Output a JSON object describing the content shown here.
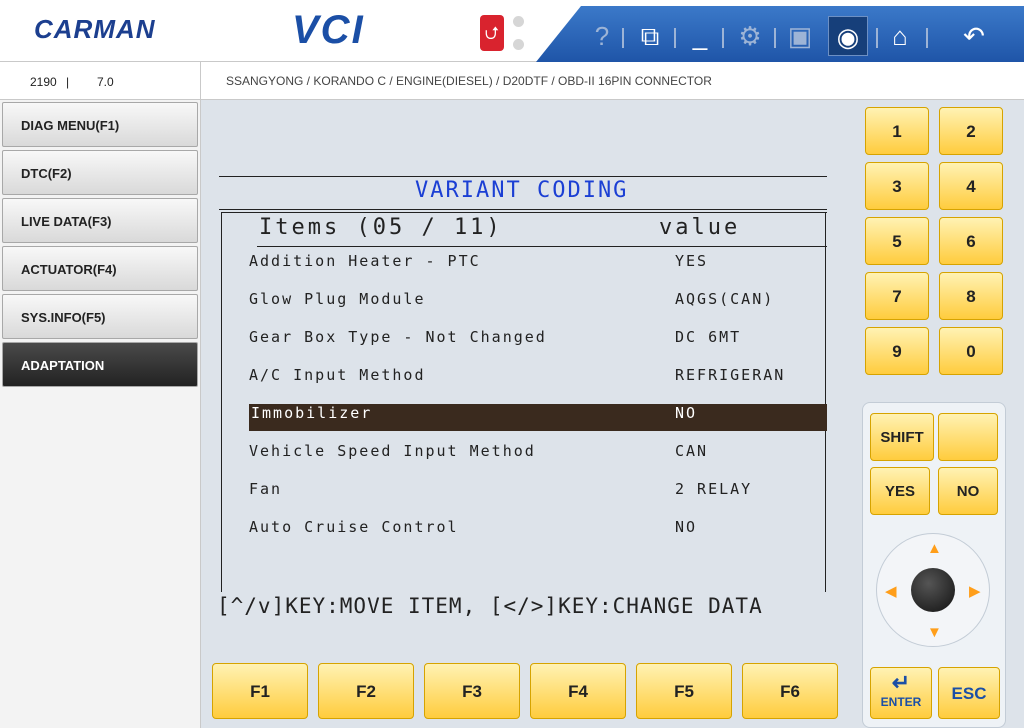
{
  "header": {
    "logo": "CARMAN",
    "product": "VCI",
    "toolbar": {
      "help_icon": "question-icon",
      "window_icon": "window-icon",
      "minimize_icon": "minimize-icon",
      "settings_icon": "gear-icon",
      "save_icon": "save-icon",
      "camera_icon": "camera-icon",
      "home_icon": "home-icon",
      "back_icon": "back-arrow-icon"
    },
    "colors": {
      "toolbar": "#2a63b8",
      "logo": "#1c3f8f",
      "usb": "#d9232e"
    }
  },
  "infobar": {
    "code": "2190",
    "separator": "|",
    "version": "7.0",
    "breadcrumb": "SSANGYONG / KORANDO C / ENGINE(DIESEL) / D20DTF / OBD-II 16PIN CONNECTOR"
  },
  "menu": {
    "items": [
      {
        "label": "DIAG MENU(F1)"
      },
      {
        "label": "DTC(F2)"
      },
      {
        "label": "LIVE DATA(F3)"
      },
      {
        "label": "ACTUATOR(F4)"
      },
      {
        "label": "SYS.INFO(F5)"
      },
      {
        "label": "ADAPTATION",
        "active": true
      }
    ]
  },
  "screen": {
    "title": "VARIANT CODING",
    "items_header": "Items (05 / 11)",
    "value_header": "value",
    "rows": [
      {
        "item": "Addition Heater - PTC",
        "value": "YES"
      },
      {
        "item": "Glow Plug Module",
        "value": "AQGS(CAN)"
      },
      {
        "item": "Gear Box Type - Not Changed",
        "value": "DC 6MT"
      },
      {
        "item": "A/C Input Method",
        "value": "REFRIGERAN"
      },
      {
        "item": "Immobilizer",
        "value": "NO",
        "selected": true
      },
      {
        "item": "Vehicle Speed Input Method",
        "value": "CAN"
      },
      {
        "item": "Fan",
        "value": "2 RELAY"
      },
      {
        "item": "Auto Cruise Control",
        "value": "NO"
      }
    ],
    "hint": "[^/v]KEY:MOVE ITEM, [</>]KEY:CHANGE DATA",
    "colors": {
      "title": "#1b3fd4",
      "highlight": "#3a2a1e"
    }
  },
  "fkeys": [
    "F1",
    "F2",
    "F3",
    "F4",
    "F5",
    "F6"
  ],
  "keypad": {
    "numbers": [
      "1",
      "2",
      "3",
      "4",
      "5",
      "6",
      "7",
      "8",
      "9",
      "0"
    ],
    "shift": "SHIFT",
    "yes": "YES",
    "no": "NO",
    "enter": "ENTER",
    "esc": "ESC",
    "colors": {
      "key": "#ffcc3d",
      "arrow": "#ff9e1a"
    }
  }
}
